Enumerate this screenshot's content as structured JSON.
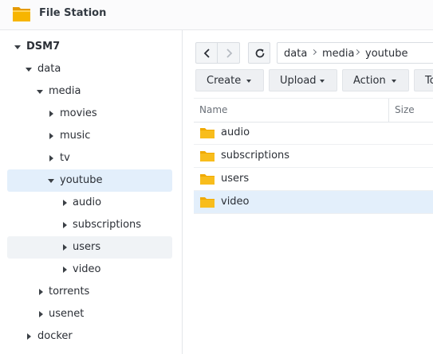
{
  "app": {
    "title": "File Station",
    "icon": "folder-icon",
    "accent": "#f6b400"
  },
  "tree": [
    {
      "label": "DSM7",
      "expanded": true,
      "bold": true
    },
    {
      "label": "data",
      "expanded": true
    },
    {
      "label": "media",
      "expanded": true
    },
    {
      "label": "movies",
      "expanded": false
    },
    {
      "label": "music",
      "expanded": false
    },
    {
      "label": "tv",
      "expanded": false
    },
    {
      "label": "youtube",
      "expanded": true,
      "selected": true
    },
    {
      "label": "audio",
      "expanded": false
    },
    {
      "label": "subscriptions",
      "expanded": false
    },
    {
      "label": "users",
      "expanded": false,
      "hovered": true
    },
    {
      "label": "video",
      "expanded": false
    },
    {
      "label": "torrents",
      "expanded": false
    },
    {
      "label": "usenet",
      "expanded": false
    },
    {
      "label": "docker",
      "expanded": false
    }
  ],
  "nav": {
    "back": "chevron-left-icon",
    "forward": "chevron-right-icon",
    "refresh": "refresh-icon",
    "path": [
      "data",
      "media",
      "youtube"
    ]
  },
  "toolbar": {
    "create": "Create",
    "upload": "Upload",
    "action": "Action",
    "tools": "To"
  },
  "grid": {
    "columns": {
      "name": "Name",
      "size": "Size"
    },
    "rows": [
      {
        "name": "audio",
        "icon": "folder-icon"
      },
      {
        "name": "subscriptions",
        "icon": "folder-icon"
      },
      {
        "name": "users",
        "icon": "folder-icon"
      },
      {
        "name": "video",
        "icon": "folder-icon",
        "selected": true
      }
    ]
  },
  "colors": {
    "selection": "#e3effb",
    "folder": "#f6b400"
  }
}
